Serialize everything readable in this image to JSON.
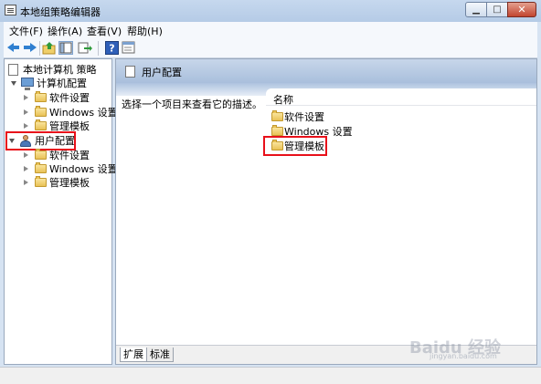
{
  "window": {
    "title": "本地组策略编辑器",
    "minimize": "▁",
    "maximize": "□",
    "close": "✕"
  },
  "menubar": [
    {
      "label": "文件(F)"
    },
    {
      "label": "操作(A)"
    },
    {
      "label": "查看(V)"
    },
    {
      "label": "帮助(H)"
    }
  ],
  "toolbar": {
    "help": "?"
  },
  "tree": {
    "root": "本地计算机 策略",
    "computer_config": "计算机配置",
    "computer_children": [
      "软件设置",
      "Windows 设置",
      "管理模板"
    ],
    "user_config": "用户配置",
    "user_children": [
      "软件设置",
      "Windows 设置",
      "管理模板"
    ]
  },
  "right_pane": {
    "header_title": "用户配置",
    "description": "选择一个项目来查看它的描述。",
    "column_name": "名称",
    "items": [
      "软件设置",
      "Windows 设置",
      "管理模板"
    ]
  },
  "tabs": [
    "扩展",
    "标准"
  ],
  "watermark": {
    "text": "Baidu 经验",
    "sub": "jingyan.baidu.com"
  },
  "highlight_color": "#e8101a"
}
